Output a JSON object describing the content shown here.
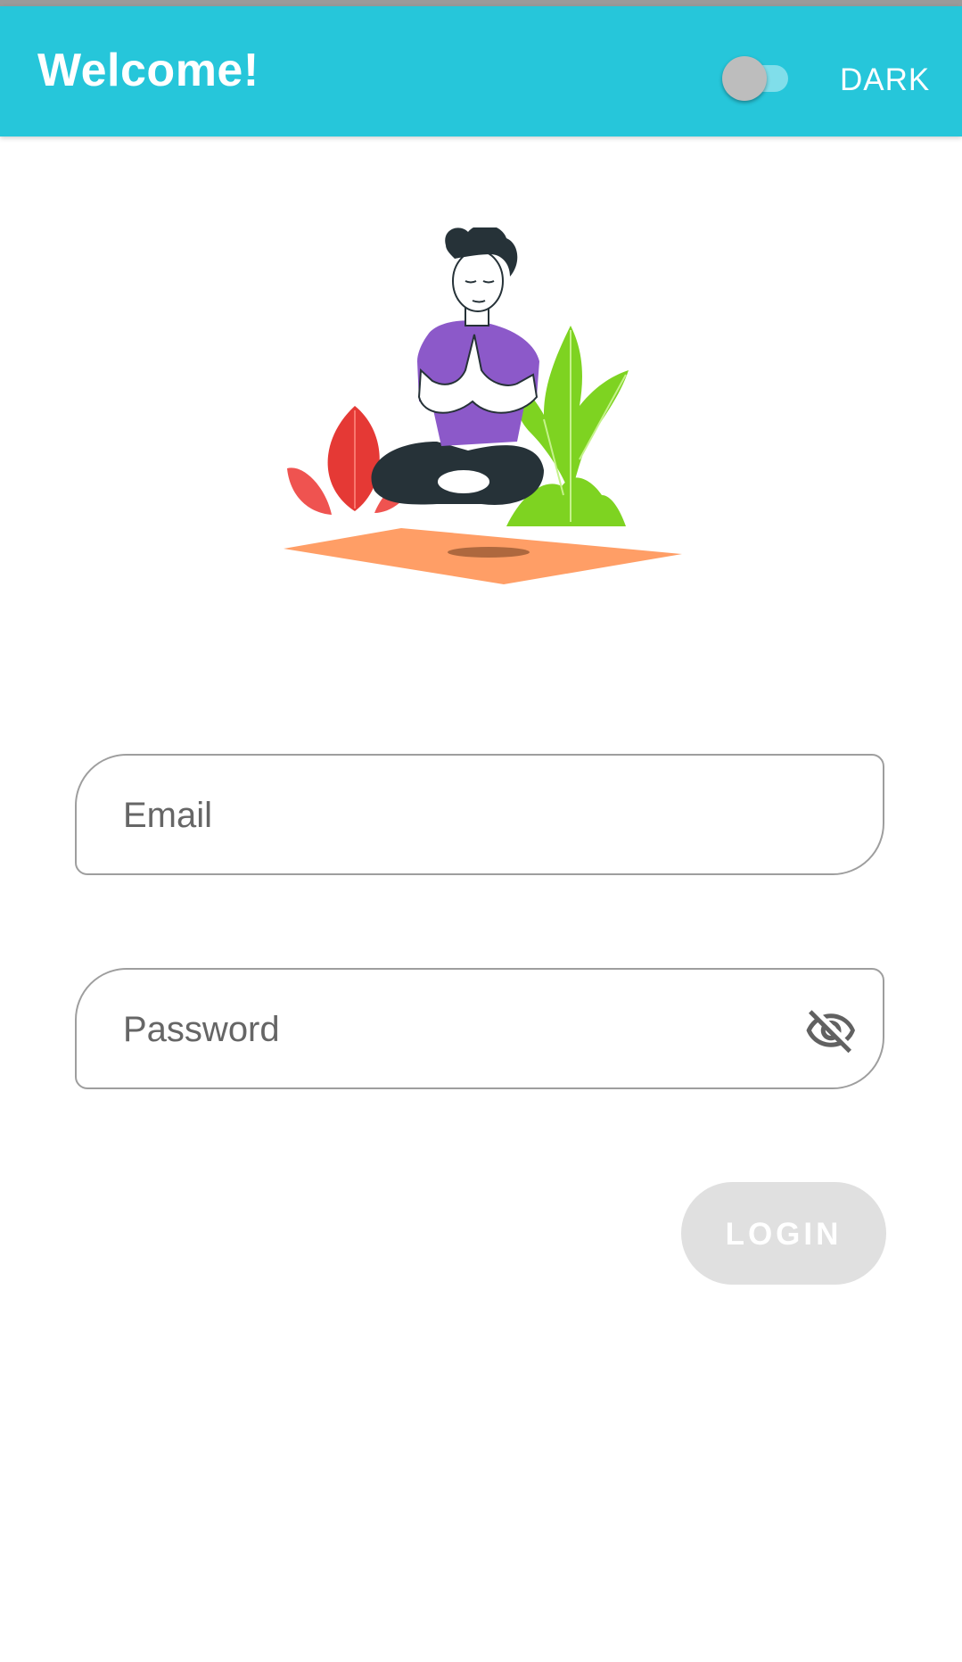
{
  "app_bar": {
    "title": "Welcome!",
    "theme_toggle": {
      "label": "DARK",
      "on": false
    },
    "background_color": "#26c6da"
  },
  "illustration": {
    "description_icon": "meditating-person-illustration"
  },
  "form": {
    "email": {
      "placeholder": "Email",
      "value": ""
    },
    "password": {
      "placeholder": "Password",
      "value": "",
      "visibility_icon": "eye-off-icon"
    },
    "login_button": {
      "label": "LOGIN",
      "enabled": false
    }
  }
}
